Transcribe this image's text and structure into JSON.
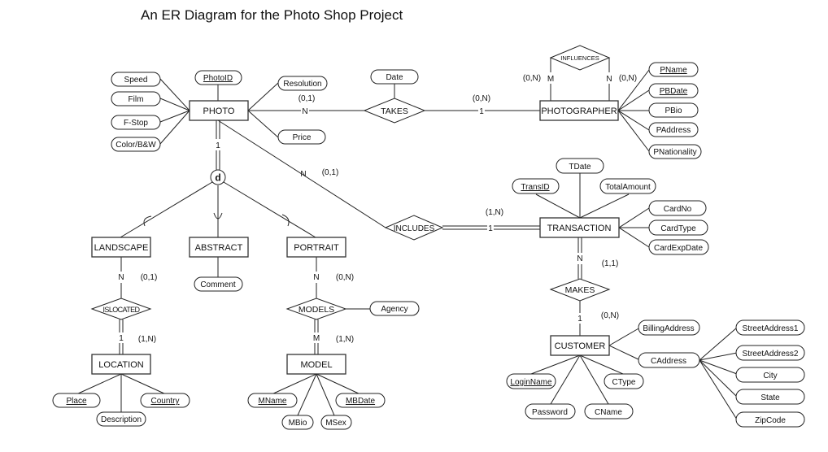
{
  "title": "An ER Diagram for the Photo Shop Project",
  "entities": [
    {
      "id": "PHOTO",
      "label": "PHOTO"
    },
    {
      "id": "PHOTOGRAPHER",
      "label": "PHOTOGRAPHER"
    },
    {
      "id": "LANDSCAPE",
      "label": "LANDSCAPE"
    },
    {
      "id": "ABSTRACT",
      "label": "ABSTRACT"
    },
    {
      "id": "PORTRAIT",
      "label": "PORTRAIT"
    },
    {
      "id": "TRANSACTION",
      "label": "TRANSACTION"
    },
    {
      "id": "LOCATION",
      "label": "LOCATION"
    },
    {
      "id": "MODEL",
      "label": "MODEL"
    },
    {
      "id": "CUSTOMER",
      "label": "CUSTOMER"
    }
  ],
  "relationships": [
    {
      "id": "TAKES",
      "label": "TAKES"
    },
    {
      "id": "INFLUENCES",
      "label": "INFLUENCES"
    },
    {
      "id": "INCLUDES",
      "label": "INCLUDES"
    },
    {
      "id": "ISLOCATED",
      "label": "ISLOCATED"
    },
    {
      "id": "MODELS",
      "label": "MODELS"
    },
    {
      "id": "MAKES",
      "label": "MAKES"
    }
  ],
  "attributes": [
    {
      "label": "Speed",
      "owner": "PHOTO",
      "key": false
    },
    {
      "label": "Film",
      "owner": "PHOTO",
      "key": false
    },
    {
      "label": "F-Stop",
      "owner": "PHOTO",
      "key": false
    },
    {
      "label": "Color/B&W",
      "owner": "PHOTO",
      "key": false
    },
    {
      "label": "PhotoID",
      "owner": "PHOTO",
      "key": true
    },
    {
      "label": "Resolution",
      "owner": "PHOTO",
      "key": false
    },
    {
      "label": "Price",
      "owner": "PHOTO",
      "key": false
    },
    {
      "label": "Date",
      "owner": "TAKES",
      "key": false
    },
    {
      "label": "PName",
      "owner": "PHOTOGRAPHER",
      "key": true
    },
    {
      "label": "PBDate",
      "owner": "PHOTOGRAPHER",
      "key": true
    },
    {
      "label": "PBio",
      "owner": "PHOTOGRAPHER",
      "key": false
    },
    {
      "label": "PAddress",
      "owner": "PHOTOGRAPHER",
      "key": false
    },
    {
      "label": "PNationality",
      "owner": "PHOTOGRAPHER",
      "key": false
    },
    {
      "label": "TDate",
      "owner": "TRANSACTION",
      "key": false
    },
    {
      "label": "TransID",
      "owner": "TRANSACTION",
      "key": true
    },
    {
      "label": "TotalAmount",
      "owner": "TRANSACTION",
      "key": false
    },
    {
      "label": "CardNo",
      "owner": "TRANSACTION",
      "key": false
    },
    {
      "label": "CardType",
      "owner": "TRANSACTION",
      "key": false
    },
    {
      "label": "CardExpDate",
      "owner": "TRANSACTION",
      "key": false
    },
    {
      "label": "Comment",
      "owner": "ABSTRACT",
      "key": false
    },
    {
      "label": "Agency",
      "owner": "MODELS",
      "key": false
    },
    {
      "label": "Place",
      "owner": "LOCATION",
      "key": true
    },
    {
      "label": "Description",
      "owner": "LOCATION",
      "key": false
    },
    {
      "label": "Country",
      "owner": "LOCATION",
      "key": true
    },
    {
      "label": "MName",
      "owner": "MODEL",
      "key": true
    },
    {
      "label": "MBio",
      "owner": "MODEL",
      "key": false
    },
    {
      "label": "MSex",
      "owner": "MODEL",
      "key": false
    },
    {
      "label": "MBDate",
      "owner": "MODEL",
      "key": true
    },
    {
      "label": "BillingAddress",
      "owner": "CUSTOMER",
      "key": false
    },
    {
      "label": "CAddress",
      "owner": "CUSTOMER",
      "key": false
    },
    {
      "label": "LoginName",
      "owner": "CUSTOMER",
      "key": true
    },
    {
      "label": "CType",
      "owner": "CUSTOMER",
      "key": false
    },
    {
      "label": "Password",
      "owner": "CUSTOMER",
      "key": false
    },
    {
      "label": "CName",
      "owner": "CUSTOMER",
      "key": false
    },
    {
      "label": "StreetAddress1",
      "owner": "CAddress",
      "key": false
    },
    {
      "label": "StreetAddress2",
      "owner": "CAddress",
      "key": false
    },
    {
      "label": "City",
      "owner": "CAddress",
      "key": false
    },
    {
      "label": "State",
      "owner": "CAddress",
      "key": false
    },
    {
      "label": "ZipCode",
      "owner": "CAddress",
      "key": false
    }
  ],
  "specialization": {
    "label": "d",
    "superclass": "PHOTO",
    "subclasses": [
      "LANDSCAPE",
      "ABSTRACT",
      "PORTRAIT"
    ]
  },
  "cardinality_labels": {
    "photo_takes_card": "N",
    "photo_takes_part": "(0,1)",
    "takes_photographer_card": "1",
    "takes_photographer_part": "(0,N)",
    "influences_m_card": "M",
    "influences_m_part": "(0,N)",
    "influences_n_card": "N",
    "influences_n_part": "(0,N)",
    "photo_includes_card": "N",
    "photo_includes_part": "(0,1)",
    "includes_transaction_card": "1",
    "includes_transaction_part": "(1,N)",
    "photo_spec_card": "1",
    "landscape_islocated_card": "N",
    "landscape_islocated_part": "(0,1)",
    "islocated_location_card": "1",
    "islocated_location_part": "(1,N)",
    "portrait_models_card": "N",
    "portrait_models_part": "(0,N)",
    "models_model_card": "M",
    "models_model_part": "(1,N)",
    "transaction_makes_card": "N",
    "transaction_makes_part": "(1,1)",
    "makes_customer_card": "1",
    "makes_customer_part": "(0,N)"
  }
}
